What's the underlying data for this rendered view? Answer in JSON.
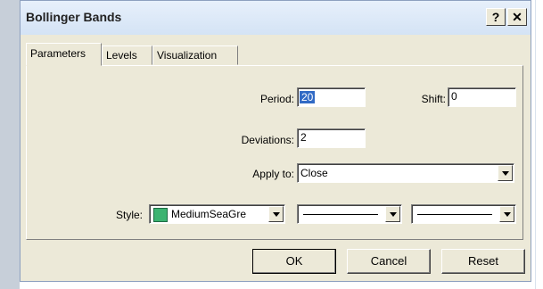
{
  "window": {
    "title": "Bollinger Bands",
    "help_label": "?",
    "close_label": "✕"
  },
  "tabs": [
    {
      "label": "Parameters",
      "active": true
    },
    {
      "label": "Levels",
      "active": false
    },
    {
      "label": "Visualization",
      "active": false
    }
  ],
  "params": {
    "period_label": "Period:",
    "period_value": "20",
    "shift_label": "Shift:",
    "shift_value": "0",
    "deviations_label": "Deviations:",
    "deviations_value": "2",
    "apply_label": "Apply to:",
    "apply_value": "Close",
    "style_label": "Style:",
    "color_name": "MediumSeaGre",
    "color_hex": "#3cb371"
  },
  "buttons": {
    "ok": "OK",
    "cancel": "Cancel",
    "reset": "Reset"
  }
}
